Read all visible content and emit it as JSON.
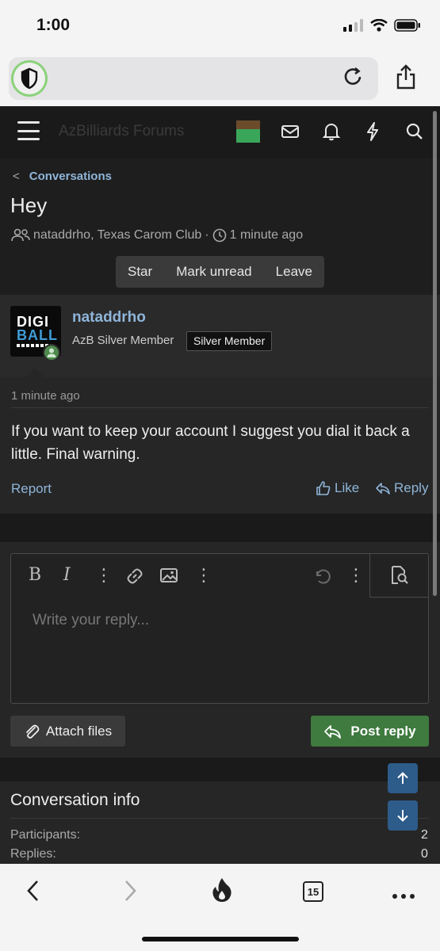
{
  "status": {
    "time": "1:00"
  },
  "site": {
    "title": "AzBilliards Forums"
  },
  "breadcrumb": {
    "label": "Conversations"
  },
  "conversation": {
    "title": "Hey",
    "participants": "nataddrho, Texas Carom Club",
    "separator": "·",
    "time_ago": "1 minute ago"
  },
  "actions": {
    "star": "Star",
    "mark_unread": "Mark unread",
    "leave": "Leave"
  },
  "message": {
    "avatar_text_1": "DIGI",
    "avatar_text_2": "BALL",
    "username": "nataddrho",
    "user_title": "AzB Silver Member",
    "badge": "Silver Member",
    "time": "1 minute ago",
    "text": "If you want to keep your account I suggest you dial it back a little. Final warning.",
    "report": "Report",
    "like": "Like",
    "reply": "Reply"
  },
  "editor": {
    "placeholder": "Write your reply...",
    "attach": "Attach files",
    "post": "Post reply"
  },
  "info": {
    "title": "Conversation info",
    "participants_label": "Participants:",
    "participants_value": "2",
    "replies_label": "Replies:",
    "replies_value": "0"
  },
  "browser": {
    "tab_count": "15"
  },
  "colors": {
    "link": "#8fb5d9",
    "post_button": "#3f7a3f",
    "scroll_button": "#2d5b8a",
    "online": "#4e8a4e"
  }
}
